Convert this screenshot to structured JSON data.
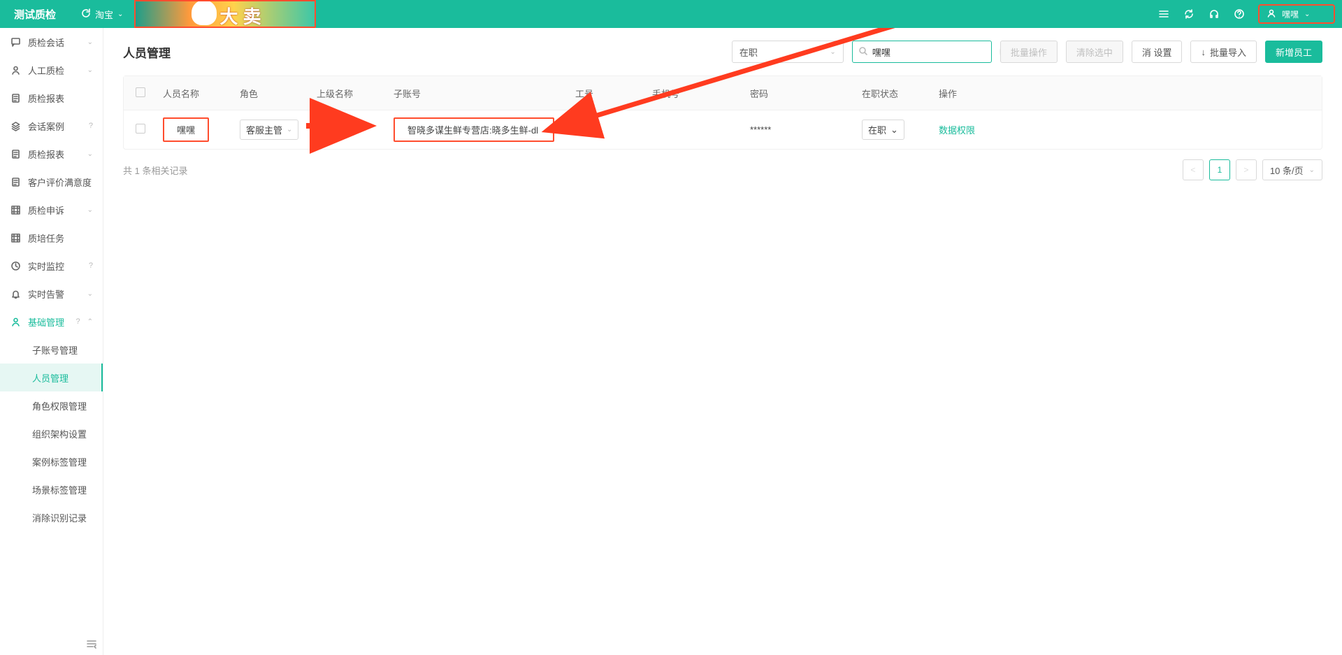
{
  "brand": "测试质检",
  "platform_label": "淘宝",
  "banner_text": "大 卖",
  "user_name": "嘿嘿",
  "sidebar": [
    {
      "icon": "chat",
      "label": "质检会话",
      "expandable": true
    },
    {
      "icon": "user",
      "label": "人工质检",
      "expandable": true
    },
    {
      "icon": "doc",
      "label": "质检报表",
      "expandable": false
    },
    {
      "icon": "layers",
      "label": "会话案例",
      "expandable": false,
      "help": true
    },
    {
      "icon": "doc",
      "label": "质检报表",
      "expandable": true
    },
    {
      "icon": "doc",
      "label": "客户评价满意度",
      "expandable": false
    },
    {
      "icon": "frame",
      "label": "质检申诉",
      "expandable": true
    },
    {
      "icon": "frame",
      "label": "质培任务",
      "expandable": false
    },
    {
      "icon": "clock",
      "label": "实时监控",
      "expandable": false,
      "help": true
    },
    {
      "icon": "bell",
      "label": "实时告警",
      "expandable": true
    },
    {
      "icon": "user",
      "label": "基础管理",
      "expandable": true,
      "open": true,
      "active": true,
      "help": true,
      "children": [
        {
          "label": "子账号管理"
        },
        {
          "label": "人员管理",
          "active": true
        },
        {
          "label": "角色权限管理"
        },
        {
          "label": "组织架构设置"
        },
        {
          "label": "案例标签管理"
        },
        {
          "label": "场景标签管理"
        },
        {
          "label": "消除识别记录"
        }
      ]
    }
  ],
  "page": {
    "title": "人员管理",
    "status_filter": "在职",
    "search_value": "嘿嘿",
    "btn_batch": "批量操作",
    "btn_clear": "清除选中",
    "btn_reset_hidden": "消    设置",
    "btn_import": "批量导入",
    "btn_add": "新增员工"
  },
  "table": {
    "headers": [
      "",
      "人员名称",
      "角色",
      "上级名称",
      "子账号",
      "工号",
      "手机号",
      "密码",
      "在职状态",
      "操作"
    ],
    "rows": [
      {
        "name": "嘿嘿",
        "role": "客服主管",
        "superior": "",
        "sub_account": "智晓多谋生鲜专营店:晓多生鲜-dl",
        "emp_no": "",
        "phone": "",
        "password": "******",
        "status": "在职",
        "action": "数据权限"
      }
    ],
    "total_text": "共 1 条相关记录",
    "page_current": "1",
    "page_size_label": "10 条/页"
  }
}
